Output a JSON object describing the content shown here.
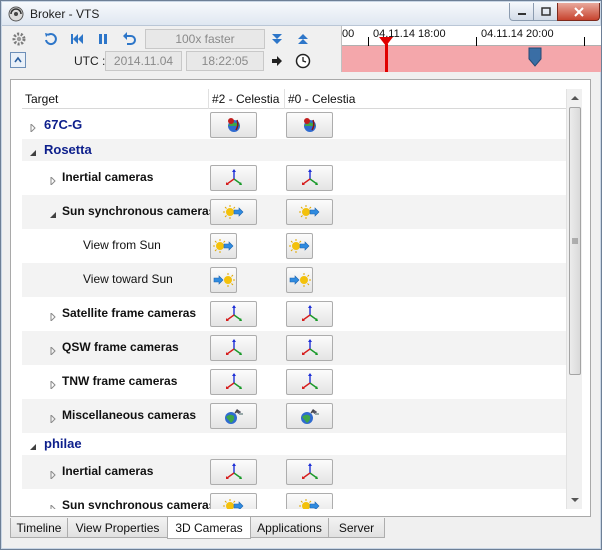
{
  "window": {
    "title": "Broker - VTS"
  },
  "toolbar": {
    "speed": "100x faster",
    "utc_label": "UTC :",
    "date": "2014.11.04",
    "time": "18:22:05"
  },
  "timeline": {
    "labels": [
      "00",
      "04.11.14 18:00",
      "04.11.14 20:00"
    ],
    "band_color": "#f4a7ab",
    "cursor_color": "#e00000",
    "marker_color": "#3a6ea5"
  },
  "grid": {
    "columns": [
      "Target",
      "#2 - Celestia",
      "#0 - Celestia"
    ],
    "rows": [
      {
        "label": "67C-G",
        "kind": "group",
        "expander": "collapsed",
        "icon": "planet-icon"
      },
      {
        "label": "Rosetta",
        "kind": "group",
        "expander": "expanded",
        "icon": ""
      },
      {
        "label": "Inertial cameras",
        "kind": "bold",
        "expander": "collapsed",
        "icon": "axes-icon"
      },
      {
        "label": "Sun synchronous cameras",
        "kind": "bold",
        "expander": "expanded",
        "icon": "sun-arrow-icon"
      },
      {
        "label": "View from Sun",
        "kind": "leaf",
        "expander": "",
        "icon": "sun-arrow-icon"
      },
      {
        "label": "View toward Sun",
        "kind": "leaf",
        "expander": "",
        "icon": "arrow-sun-icon"
      },
      {
        "label": "Satellite frame cameras",
        "kind": "bold",
        "expander": "collapsed",
        "icon": "axes-icon"
      },
      {
        "label": "QSW frame cameras",
        "kind": "bold",
        "expander": "collapsed",
        "icon": "axes-icon"
      },
      {
        "label": "TNW frame cameras",
        "kind": "bold",
        "expander": "collapsed",
        "icon": "axes-icon"
      },
      {
        "label": "Miscellaneous cameras",
        "kind": "bold",
        "expander": "collapsed",
        "icon": "satellite-globe-icon"
      },
      {
        "label": "philae",
        "kind": "group",
        "expander": "expanded",
        "icon": ""
      },
      {
        "label": "Inertial cameras",
        "kind": "bold",
        "expander": "collapsed",
        "icon": "axes-icon"
      },
      {
        "label": "Sun synchronous cameras",
        "kind": "bold",
        "expander": "collapsed",
        "icon": "sun-arrow-icon"
      }
    ]
  },
  "tabs": [
    {
      "label": "Timeline",
      "active": false
    },
    {
      "label": "View Properties",
      "active": false
    },
    {
      "label": "3D Cameras",
      "active": true
    },
    {
      "label": "Applications",
      "active": false
    },
    {
      "label": "Server",
      "active": false
    }
  ]
}
